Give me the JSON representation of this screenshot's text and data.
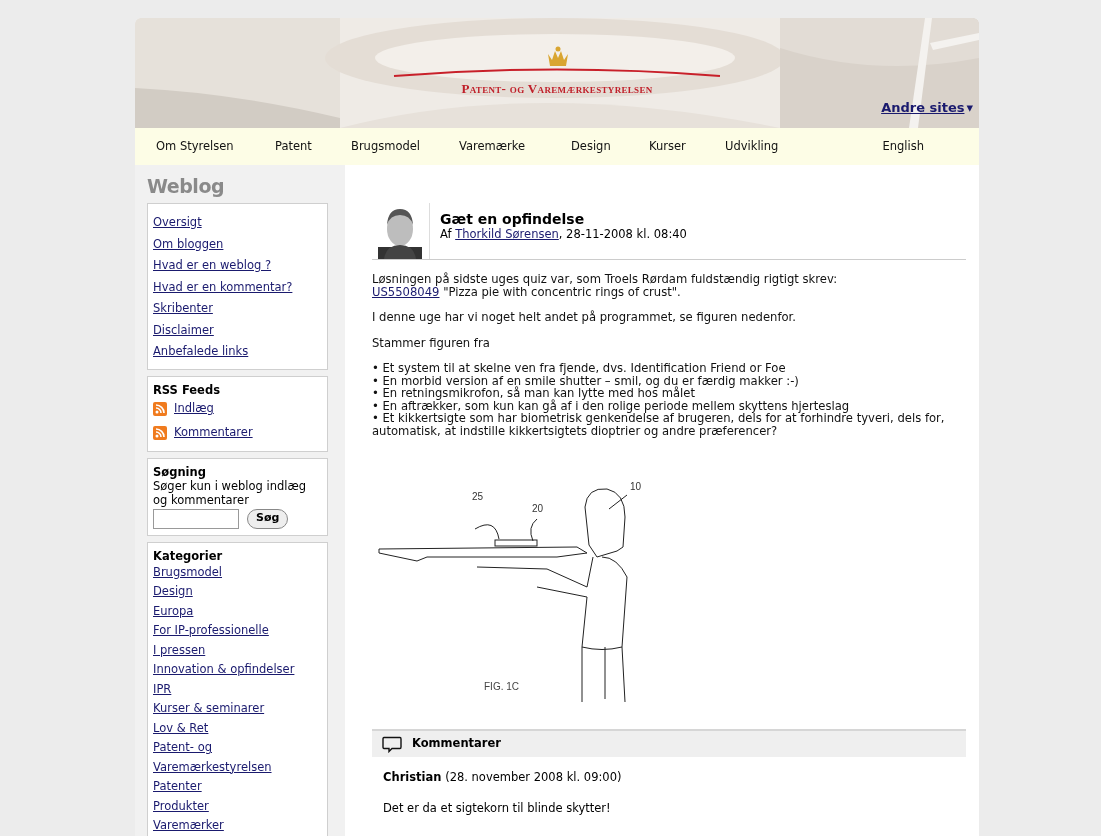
{
  "header": {
    "logo": "Patent- og Varemærkestyrelsen",
    "other_sites": "Andre sites",
    "other_sites_caret": "▾"
  },
  "nav": [
    {
      "label": "Om Styrelsen"
    },
    {
      "label": "Patent"
    },
    {
      "label": "Brugsmodel"
    },
    {
      "label": "Varemærke"
    },
    {
      "label": "Design"
    },
    {
      "label": "Kurser"
    },
    {
      "label": "Udvikling"
    },
    {
      "label": "English"
    }
  ],
  "sidebar": {
    "title": "Weblog",
    "links": [
      "Oversigt",
      "Om bloggen",
      "Hvad er en weblog ?",
      "Hvad er en kommentar?",
      "Skribenter",
      "Disclaimer",
      "Anbefalede links"
    ],
    "rss": {
      "title": "RSS Feeds",
      "links": [
        "Indlæg",
        "Kommentarer"
      ]
    },
    "search": {
      "title": "Søgning",
      "hint": "Søger kun i weblog indlæg og kommentarer",
      "button": "Søg"
    },
    "categories": {
      "title": "Kategorier",
      "links": [
        "Brugsmodel",
        "Design",
        "Europa",
        "For IP-professionelle",
        "I pressen",
        "Innovation & opfindelser",
        "IPR",
        "Kurser & seminarer",
        "Lov & Ret",
        "Patent- og",
        "Varemærkestyrelsen",
        "Patenter",
        "Produkter",
        "Varemærker"
      ]
    }
  },
  "post": {
    "title": "Gæt en opfindelse",
    "byline_prefix": "Af",
    "author": "Thorkild Sørensen",
    "date": ", 28-11-2008 kl. 08:40",
    "intro_line": "Løsningen på sidste uges quiz var, som Troels Rørdam fuldstændig rigtigt skrev:",
    "patent_link": "US5508049",
    "patent_title": " \"Pizza pie with concentric rings of crust\".",
    "paragraphs": [
      "I denne uge har vi noget helt andet på programmet, se figuren nedenfor.",
      "Stammer figuren fra"
    ],
    "bullets": [
      "• Et system til at skelne ven fra fjende, dvs. Identification Friend or Foe",
      "• En morbid version af en smile shutter – smil, og du er færdig makker :-)",
      "• En retningsmikrofon, så man kan lytte med hos målet",
      "• En aftrækker, som kun kan gå af i den rolige periode mellem skyttens hjerteslag",
      "• Et kikkertsigte som har biometrisk genkendelse af brugeren, dels for at forhindre tyveri, dels for, automatisk, at indstille kikkertsigtets dioptrier og andre præferencer?"
    ],
    "figure": {
      "labels": [
        "25",
        "20",
        "10"
      ],
      "caption": "FIG. 1C"
    }
  },
  "comments": {
    "title": "Kommentarer",
    "items": [
      {
        "author": "Christian",
        "date": " (28. november 2008 kl. 09:00)",
        "text": "Det er da et sigtekorn til blinde skytter!"
      }
    ]
  }
}
